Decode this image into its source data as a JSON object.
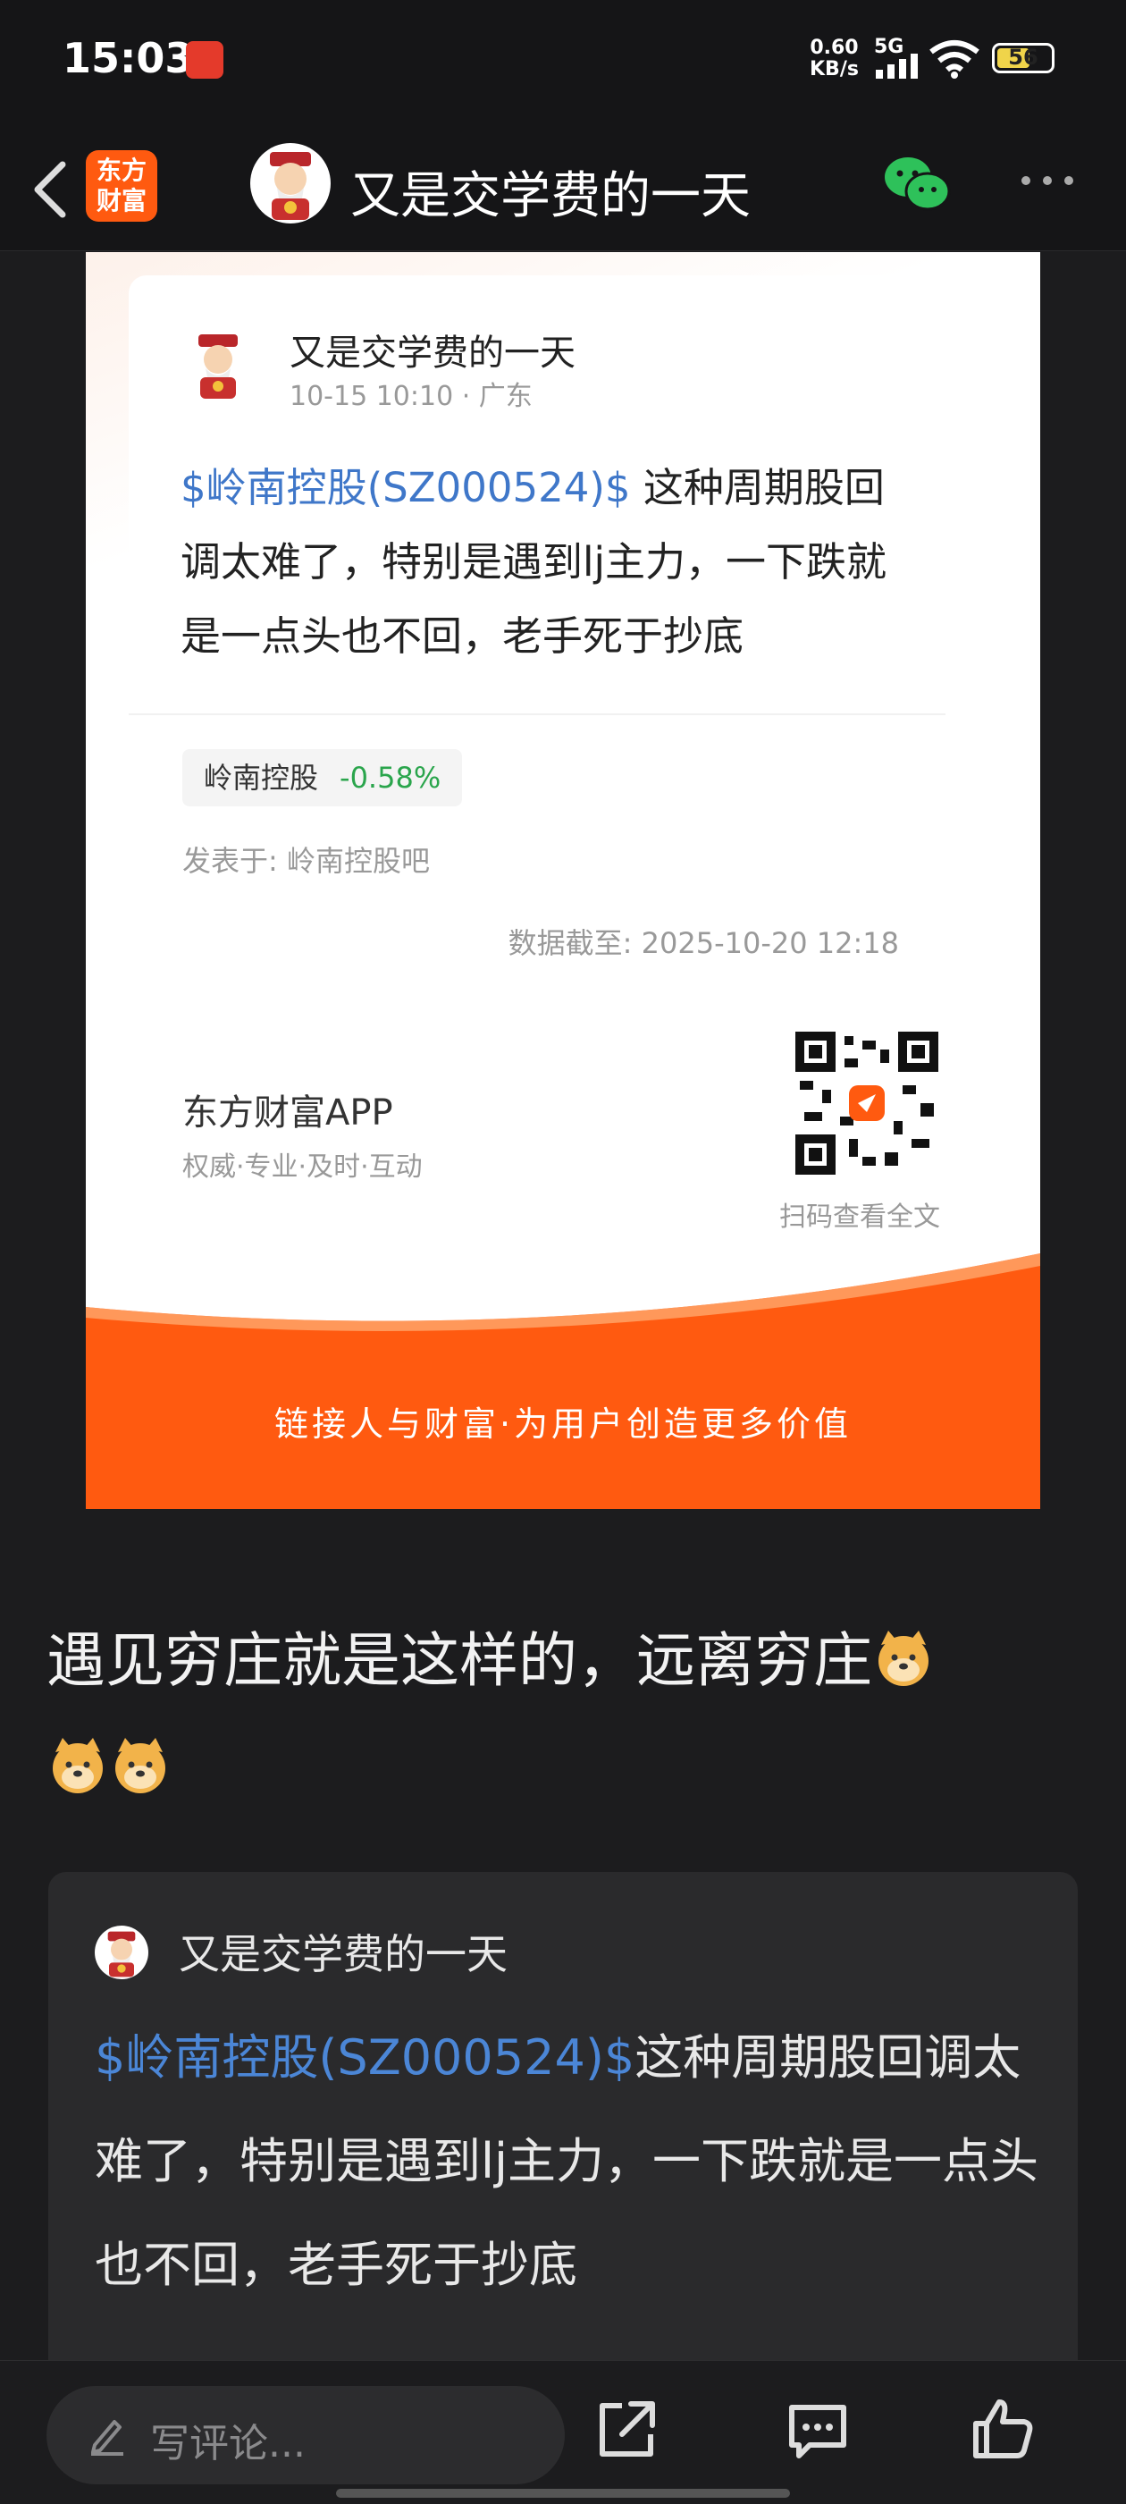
{
  "status_bar": {
    "time": "15:03",
    "net_speed_value": "0.60",
    "net_speed_unit": "KB/s",
    "network": "5G",
    "battery": "56"
  },
  "nav": {
    "logo_line1": "东方",
    "logo_line2": "财富",
    "title": "又是交学费的一天"
  },
  "share_card": {
    "author": "又是交学费的一天",
    "meta": "10-15 10:10 · 广东",
    "stock_tag": "$岭南控股(SZ000524)$",
    "text": "这种周期股回调太难了，特别是遇到lj主力，一下跌就是一点头也不回，老手死于抄底",
    "stock_name": "岭南控股",
    "stock_change": "-0.58%",
    "posted_in": "发表于: 岭南控股吧",
    "data_time": "数据截至: 2025-10-20 12:18",
    "brand_name": "东方财富APP",
    "brand_slogan": "权威·专业·及时·互动",
    "qr_caption": "扫码查看全文",
    "footer_slogan": "链接人与财富·为用户创造更多价值",
    "accent_color": "#ff5a10"
  },
  "comment": {
    "text": "遇见穷庄就是这样的，远离穷庄",
    "emoji_count": 3
  },
  "quote": {
    "author": "又是交学费的一天",
    "stock_tag": "$岭南控股(SZ000524)$",
    "text": "这种周期股回调太难了，特别是遇到lj主力，一下跌就是一点头也不回，老手死于抄底"
  },
  "bottom_bar": {
    "comment_placeholder": "写评论..."
  }
}
